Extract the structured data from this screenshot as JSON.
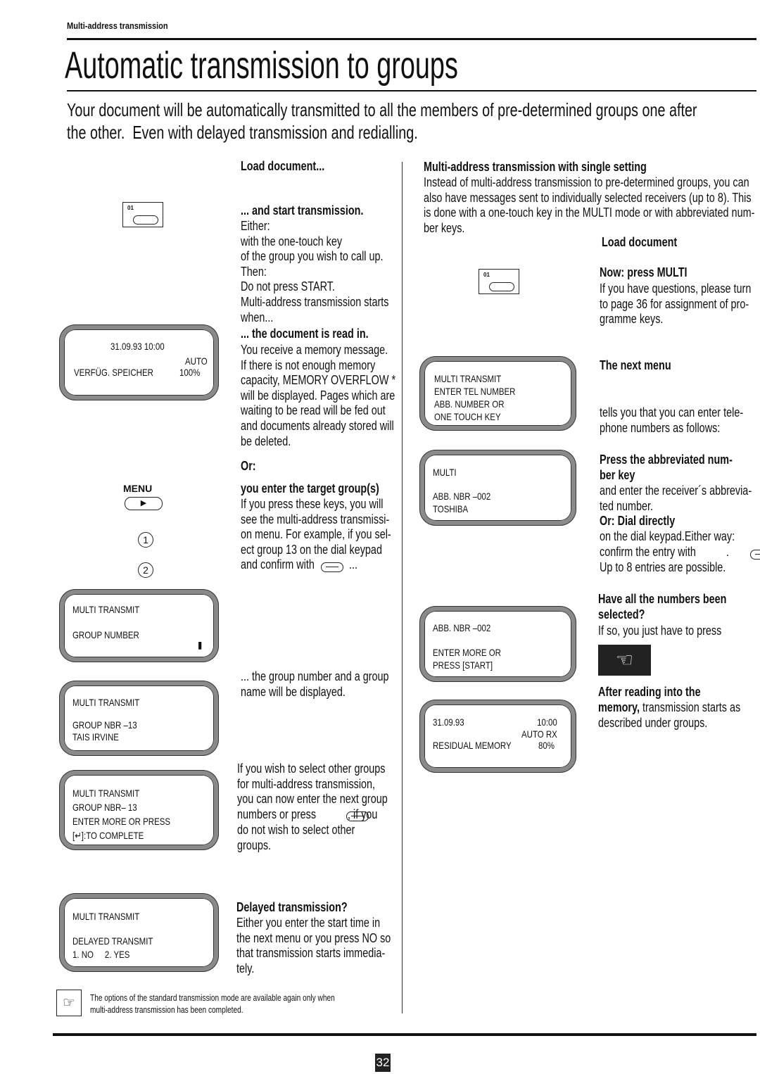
{
  "header": {
    "section": "Multi-address transmission",
    "title": "Automatic transmission to groups",
    "intro": "Your document will be automatically transmitted to all the members of pre-determined groups one after\nthe other.  Even with delayed transmission and redialling."
  },
  "middle": {
    "load_heading": "Load document...",
    "start_heading": "... and start transmission.",
    "start_text": "Either:\nwith the one-touch key\nof the group you wish to call up.\nThen:\nDo not press START.\nMulti-address transmission starts\nwhen...",
    "read_heading": "... the document is read in.",
    "read_text": "You receive a memory message.\nIf there is not enough memory\ncapacity, MEMORY OVERFLOW *\nwill be displayed. Pages which are\nwaiting to be read will be fed out\nand documents already stored will\nbe deleted.",
    "or_heading": "Or:",
    "target_heading": "you enter the target group(s)",
    "target_text": "If you press these keys, you will\nsee the multi-address transmissi-\non menu. For example, if you sel-\nect group 13 on the dial keypad\nand confirm with",
    "target_tail": " ...",
    "group_text": "... the group number and a group\nname will be displayed.",
    "other_text": "If you wish to select other groups\nfor multi-address transmission,\nyou can now enter the next group\nnumbers or press",
    "other_tail": " , if you",
    "other_text2": "do not wish to select other\ngroups.",
    "delayed_heading": "Delayed transmission?",
    "delayed_text": "Either you enter the start time in\nthe next menu or you press NO so\nthat transmission starts immedia-\ntely.",
    "note": "The options of the standard transmission mode are available again only when\nmulti-address transmission has been completed."
  },
  "right": {
    "single_heading": "Multi-address transmission with single setting",
    "single_text": "Instead of multi-address transmission to pre-determined groups, you can\nalso have messages sent to individually selected receivers (up to 8). This\nis done with a one-touch key in the MULTI mode or with abbreviated num-\nber keys.",
    "load_heading": "Load document",
    "multi_heading": "Now: press MULTI",
    "multi_text": "If you have questions, please turn\nto page 36 for assignment of pro-\ngramme keys.",
    "next_heading": "The next menu",
    "next_text": "tells you that you can enter tele-\nphone numbers as follows:",
    "abbr_heading": "Press the abbreviated num-\nber key",
    "abbr_text": "and enter the receiver´s abbrevia-\nted number.",
    "dial_heading": "Or: Dial directly",
    "dial_text": "on the dial keypad.Either way:\nconfirm the entry with",
    "dial_tail": " .",
    "dial_text2": "Up to 8 entries are possible.",
    "all_heading": "Have all the numbers been\nselected?",
    "all_text": "If so, you just have to press",
    "after_heading": "After reading into the\nmemory,",
    "after_text": " transmission starts as",
    "after_text2": "described under groups."
  },
  "keys": {
    "one_touch": "01",
    "menu": "MENU",
    "digit1": "1",
    "digit2": "2"
  },
  "displays": {
    "d1": {
      "l1": "31.09.93 10:00",
      "l2": "AUTO",
      "l3": "VERFÜG. SPEICHER",
      "l4": "100%"
    },
    "d2": {
      "l1": "MULTI TRANSMIT",
      "l2": "GROUP NUMBER",
      "l3": "▮"
    },
    "d3": {
      "l1": "MULTI TRANSMIT",
      "l2": "GROUP NBR –13\nTAIS IRVINE"
    },
    "d4": {
      "l1": "MULTI TRANSMIT\nGROUP NBR– 13\nENTER MORE OR PRESS\n[↵]:TO COMPLETE"
    },
    "d5": {
      "l1": "MULTI TRANSMIT",
      "l2": "DELAYED TRANSMIT\n1. NO     2. YES"
    },
    "r1": {
      "l1": "MULTI TRANSMIT\nENTER TEL NUMBER\nABB. NUMBER OR\nONE TOUCH KEY"
    },
    "r2": {
      "l1": "MULTI",
      "l2": "ABB. NBR –002\nTOSHIBA"
    },
    "r3": {
      "l1": "ABB. NBR –002",
      "l2": "ENTER MORE OR\nPRESS [START]"
    },
    "r4": {
      "l1": "31.09.93",
      "l2": "10:00\nAUTO RX",
      "l3": "RESIDUAL MEMORY",
      "l4": "80%"
    }
  },
  "footer": {
    "page_number": "32"
  }
}
